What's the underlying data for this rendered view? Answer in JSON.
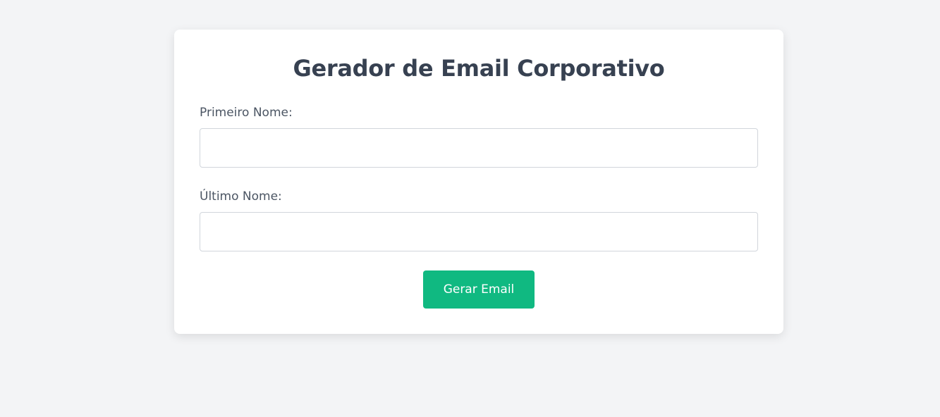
{
  "page": {
    "title": "Gerador de Email Corporativo"
  },
  "form": {
    "first_name": {
      "label": "Primeiro Nome:",
      "value": "",
      "placeholder": ""
    },
    "last_name": {
      "label": "Último Nome:",
      "value": "",
      "placeholder": ""
    },
    "submit_label": "Gerar Email"
  },
  "colors": {
    "background": "#f3f4f6",
    "card": "#ffffff",
    "title": "#374151",
    "accent": "#10b981"
  }
}
